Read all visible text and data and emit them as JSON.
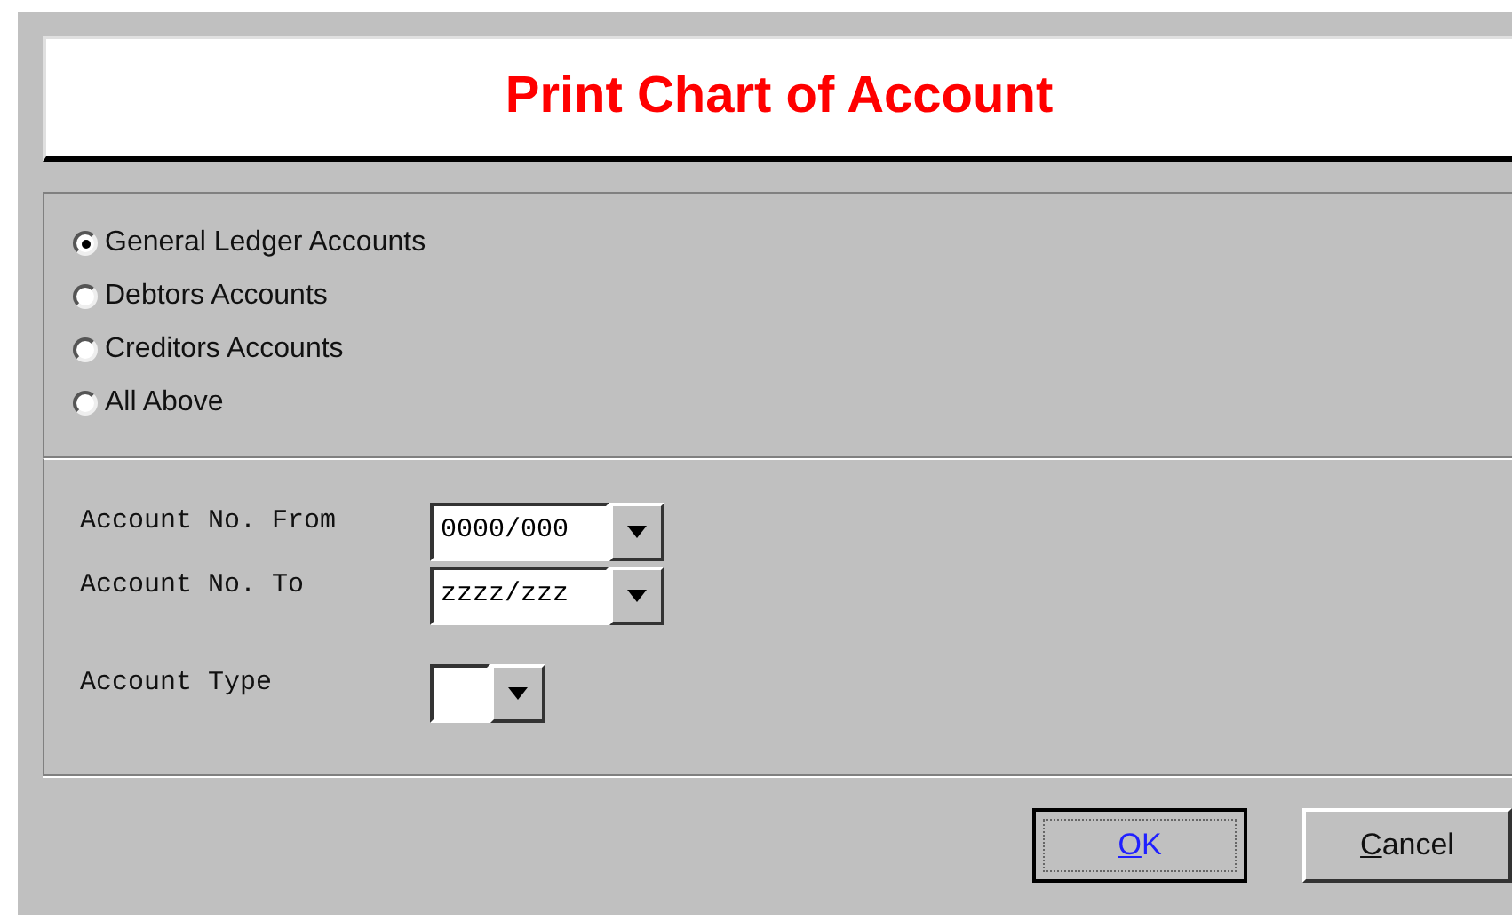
{
  "title": "Print Chart of Account",
  "account_options": [
    {
      "label": "General Ledger Accounts",
      "selected": true
    },
    {
      "label": "Debtors Accounts",
      "selected": false
    },
    {
      "label": "Creditors Accounts",
      "selected": false
    },
    {
      "label": "All Above",
      "selected": false
    }
  ],
  "fields": [
    {
      "label": "Account No. From",
      "value": "0000/000",
      "kind": "wide"
    },
    {
      "label": "Account No. To",
      "value": "zzzz/zzz",
      "kind": "wide"
    },
    {
      "label": "Account Type",
      "kind": "narrow"
    }
  ],
  "buttons": [
    {
      "label": "OK",
      "focused": true
    },
    {
      "label": "Cancel",
      "focused": false
    }
  ]
}
